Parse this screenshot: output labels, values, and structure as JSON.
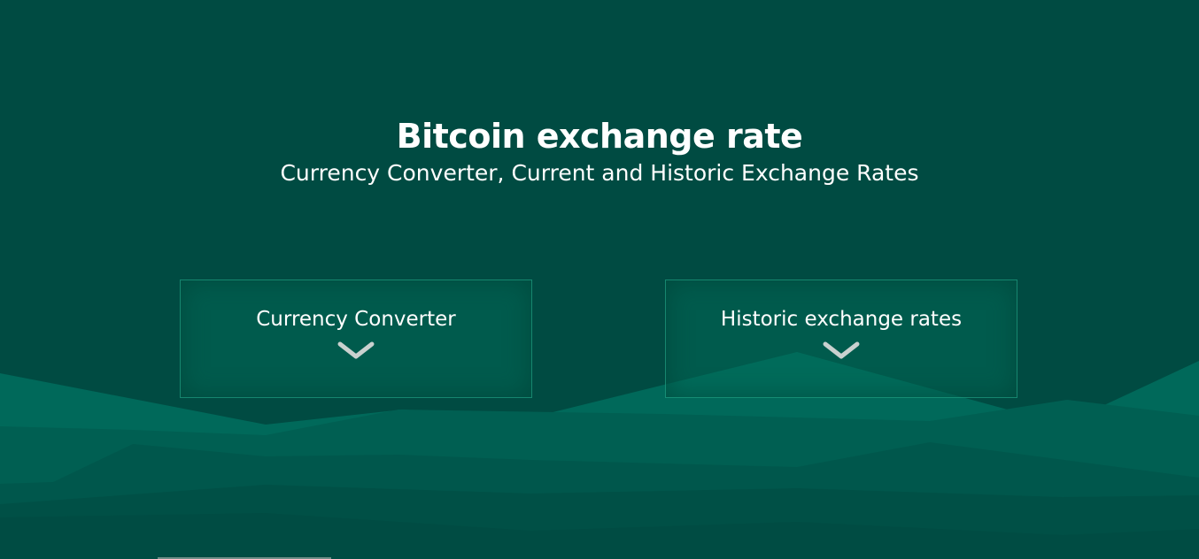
{
  "hero": {
    "title": "Bitcoin exchange rate",
    "subtitle": "Currency Converter, Current and Historic Exchange Rates"
  },
  "nav_cards": [
    {
      "label": "Currency Converter",
      "icon": "chevron-down-icon"
    },
    {
      "label": "Historic exchange rates",
      "icon": "chevron-down-icon"
    }
  ],
  "colors": {
    "background": "#004b42",
    "text": "#ffffff",
    "mountain_light": "#006b56",
    "mountain_mid": "#00594e",
    "mountain_dark": "#004f45",
    "chevron": "#c9d1cf"
  }
}
